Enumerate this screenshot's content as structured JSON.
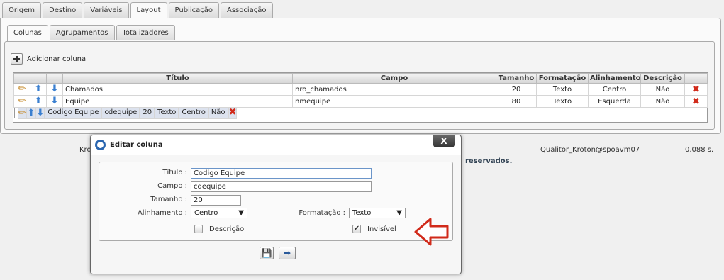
{
  "tabs": [
    "Origem",
    "Destino",
    "Variáveis",
    "Layout",
    "Publicação",
    "Associação"
  ],
  "subtabs": [
    "Colunas",
    "Agrupamentos",
    "Totalizadores"
  ],
  "add_label": "Adicionar coluna",
  "columns": [
    "Título",
    "Campo",
    "Tamanho",
    "Formatação",
    "Alinhamento",
    "Descrição"
  ],
  "rows": [
    {
      "titulo": "Chamados",
      "campo": "nro_chamados",
      "tamanho": "20",
      "formatacao": "Texto",
      "alinhamento": "Centro",
      "descricao": "Não"
    },
    {
      "titulo": "Equipe",
      "campo": "nmequipe",
      "tamanho": "80",
      "formatacao": "Texto",
      "alinhamento": "Esquerda",
      "descricao": "Não"
    },
    {
      "titulo": "Codigo Equipe",
      "campo": "cdequipe",
      "tamanho": "20",
      "formatacao": "Texto",
      "alinhamento": "Centro",
      "descricao": "Não"
    }
  ],
  "footer": {
    "left": "Kro",
    "right_bold": "reservados.",
    "user": "Qualitor_Kroton@spoavm07",
    "time": "0.088 s."
  },
  "dialog": {
    "title": "Editar coluna",
    "close": "X",
    "titulo_label": "Título :",
    "titulo_value": "Codigo Equipe",
    "campo_label": "Campo :",
    "campo_value": "cdequipe",
    "tamanho_label": "Tamanho :",
    "tamanho_value": "20",
    "alinhamento_label": "Alinhamento :",
    "alinhamento_value": "Centro",
    "formatacao_label": "Formatação :",
    "formatacao_value": "Texto",
    "descricao_label": "Descrição",
    "descricao_checked": false,
    "invisivel_label": "Invisível",
    "invisivel_checked": true
  },
  "colors": {
    "accent": "#2a66b0",
    "arrow": "#d12a1a",
    "selected_row": "#dce2ee"
  }
}
